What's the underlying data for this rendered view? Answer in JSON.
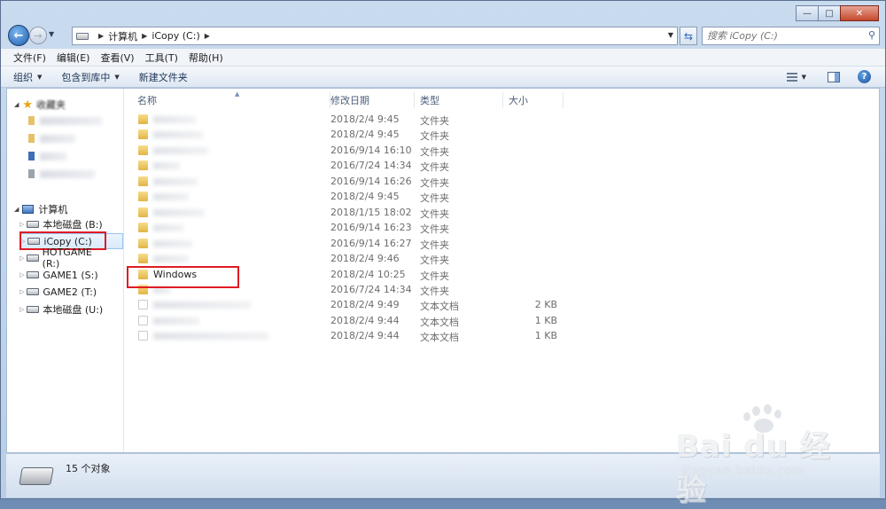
{
  "window": {
    "min_label": "—",
    "max_label": "□",
    "close_label": "✕"
  },
  "nav": {
    "back_label": "←",
    "forward_label": "→"
  },
  "address": {
    "crumbs": [
      "计算机",
      "iCopy (C:)"
    ]
  },
  "search": {
    "placeholder": "搜索 iCopy (C:)"
  },
  "menu": [
    "文件(F)",
    "编辑(E)",
    "查看(V)",
    "工具(T)",
    "帮助(H)"
  ],
  "toolbar": {
    "organize": "组织",
    "include": "包含到库中",
    "new_folder": "新建文件夹"
  },
  "sidebar": {
    "favorites_label": "收藏夹",
    "computer_label": "计算机",
    "drives": [
      "本地磁盘 (B:)",
      "iCopy (C:)",
      "HOTGAME (R:)",
      "GAME1 (S:)",
      "GAME2 (T:)",
      "本地磁盘 (U:)"
    ],
    "selected_index": 1
  },
  "columns": {
    "name": "名称",
    "modified": "修改日期",
    "type": "类型",
    "size": "大小"
  },
  "files": [
    {
      "name": "",
      "date": "2018/2/4 9:45",
      "type": "文件夹",
      "size": "",
      "kind": "folder"
    },
    {
      "name": "",
      "date": "2018/2/4 9:45",
      "type": "文件夹",
      "size": "",
      "kind": "folder"
    },
    {
      "name": "",
      "date": "2016/9/14 16:10",
      "type": "文件夹",
      "size": "",
      "kind": "folder"
    },
    {
      "name": "",
      "date": "2016/7/24 14:34",
      "type": "文件夹",
      "size": "",
      "kind": "folder"
    },
    {
      "name": "",
      "date": "2016/9/14 16:26",
      "type": "文件夹",
      "size": "",
      "kind": "folder"
    },
    {
      "name": "",
      "date": "2018/2/4 9:45",
      "type": "文件夹",
      "size": "",
      "kind": "folder"
    },
    {
      "name": "",
      "date": "2018/1/15 18:02",
      "type": "文件夹",
      "size": "",
      "kind": "folder"
    },
    {
      "name": "",
      "date": "2016/9/14 16:23",
      "type": "文件夹",
      "size": "",
      "kind": "folder"
    },
    {
      "name": "",
      "date": "2016/9/14 16:27",
      "type": "文件夹",
      "size": "",
      "kind": "folder"
    },
    {
      "name": "",
      "date": "2018/2/4 9:46",
      "type": "文件夹",
      "size": "",
      "kind": "folder"
    },
    {
      "name": "Windows",
      "date": "2018/2/4 10:25",
      "type": "文件夹",
      "size": "",
      "kind": "folder"
    },
    {
      "name": "",
      "date": "2016/7/24 14:34",
      "type": "文件夹",
      "size": "",
      "kind": "folder"
    },
    {
      "name": "",
      "date": "2018/2/4 9:49",
      "type": "文本文档",
      "size": "2 KB",
      "kind": "doc"
    },
    {
      "name": "",
      "date": "2018/2/4 9:44",
      "type": "文本文档",
      "size": "1 KB",
      "kind": "doc"
    },
    {
      "name": "",
      "date": "2018/2/4 9:44",
      "type": "文本文档",
      "size": "1 KB",
      "kind": "doc"
    }
  ],
  "status": {
    "count": "15 个对象"
  },
  "watermark": {
    "brand": "Bai du 经验",
    "url": "jingyan.baidu.com"
  }
}
